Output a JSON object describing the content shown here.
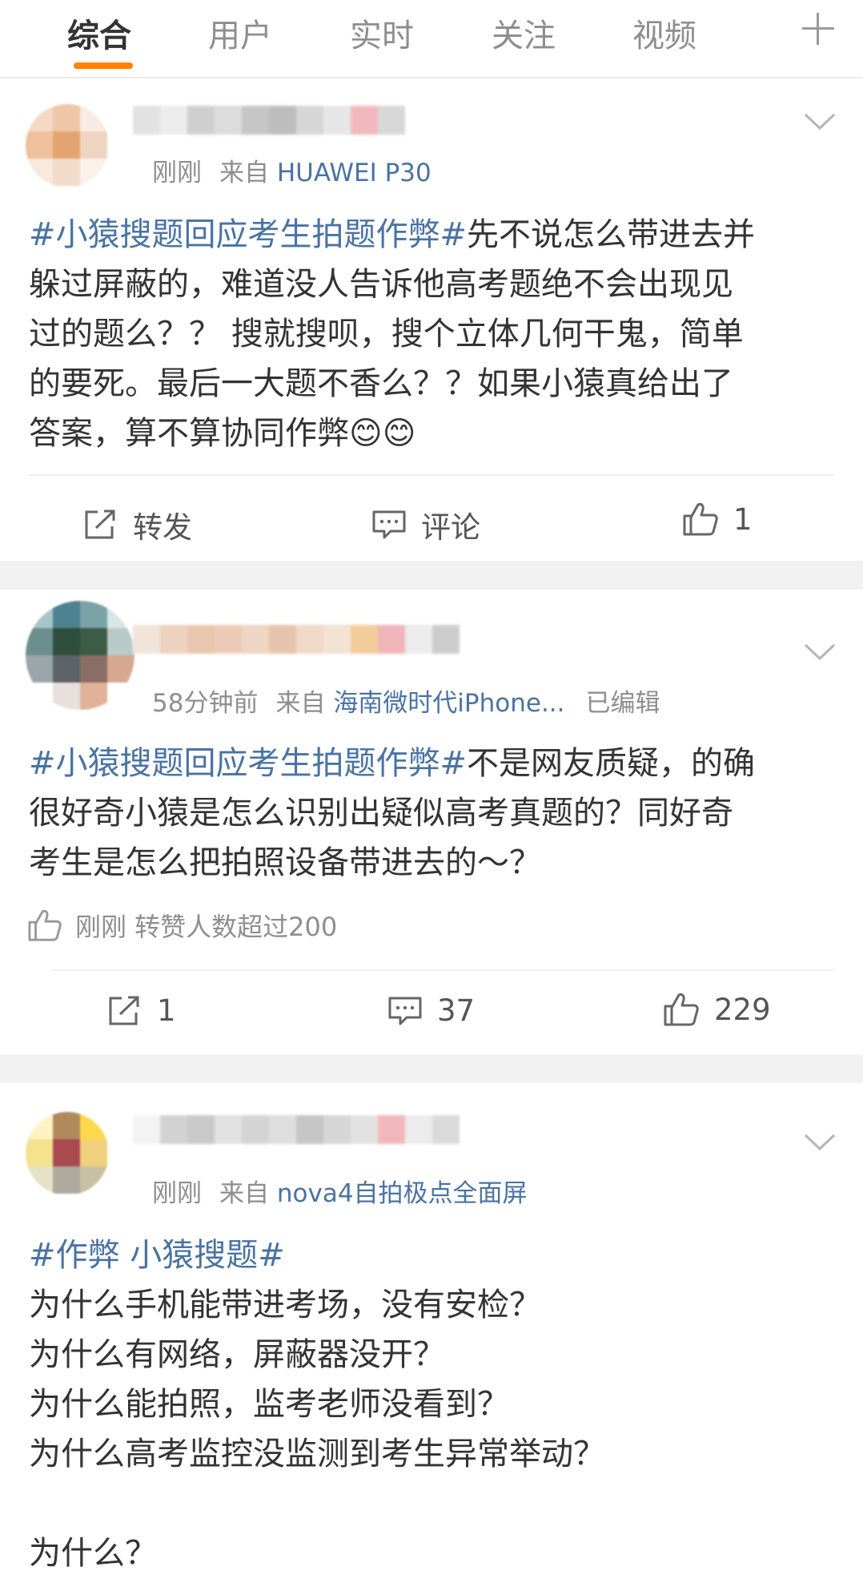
{
  "tabs": [
    {
      "label": "综合",
      "active": true
    },
    {
      "label": "用户",
      "active": false
    },
    {
      "label": "实时",
      "active": false
    },
    {
      "label": "关注",
      "active": false
    },
    {
      "label": "视频",
      "active": false
    }
  ],
  "colors": {
    "accent": "#ff8200",
    "link": "#4a73a3",
    "meta": "#8e8e8e",
    "separator": "#f2f2f2"
  },
  "posts": [
    {
      "time": "刚刚",
      "from_label": "来自",
      "source": "HUAWEI P30",
      "topic": "#小猿搜题回应考生拍题作弊#",
      "body": "先不说怎么带进去并\n躲过屏蔽的，难道没人告诉他高考题绝不会出现见\n过的题么？？ 搜就搜呗，搜个立体几何干鬼，简单\n的要死。最后一大题不香么？？如果小猿真给出了\n答案，算不算协同作弊😊😊",
      "repost_label": "转发",
      "comment_label": "评论",
      "like_count": "1"
    },
    {
      "time": "58分钟前",
      "from_label": "来自",
      "source": "海南微时代iPhone...",
      "edited": "已编辑",
      "topic": "#小猿搜题回应考生拍题作弊#",
      "body": "不是网友质疑，的确\n很好奇小猿是怎么识别出疑似高考真题的？同好奇\n考生是怎么把拍照设备带进去的～？",
      "like_note": "刚刚 转赞人数超过200",
      "repost_count": "1",
      "comment_count": "37",
      "like_count": "229"
    },
    {
      "time": "刚刚",
      "from_label": "来自",
      "source": "nova4自拍极点全面屏",
      "topic": "#作弊 小猿搜题#",
      "body": "\n为什么手机能带进考场，没有安检？\n为什么有网络，屏蔽器没开？\n为什么能拍照，监考老师没看到？\n为什么高考监控没监测到考生异常举动？\n\n为什么？"
    }
  ]
}
